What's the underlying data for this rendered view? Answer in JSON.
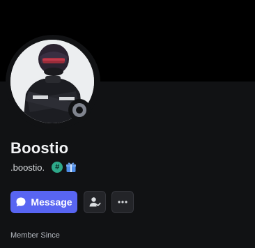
{
  "profile": {
    "display_name": "Boostio",
    "username": ".boostio.",
    "status": "offline",
    "avatar_description": "racing driver in helmet and black suit",
    "badges": [
      "hashtag-badge-icon",
      "gift-badge-icon"
    ]
  },
  "actions": {
    "message_label": "Message",
    "friend_icon": "add-friend-icon",
    "more_icon": "more-icon"
  },
  "sections": {
    "member_since_label": "Member Since"
  },
  "colors": {
    "background": "#111214",
    "banner": "#000000",
    "accent": "#5865f2",
    "badge_green": "#2ea98a",
    "status_offline": "#80848e"
  }
}
